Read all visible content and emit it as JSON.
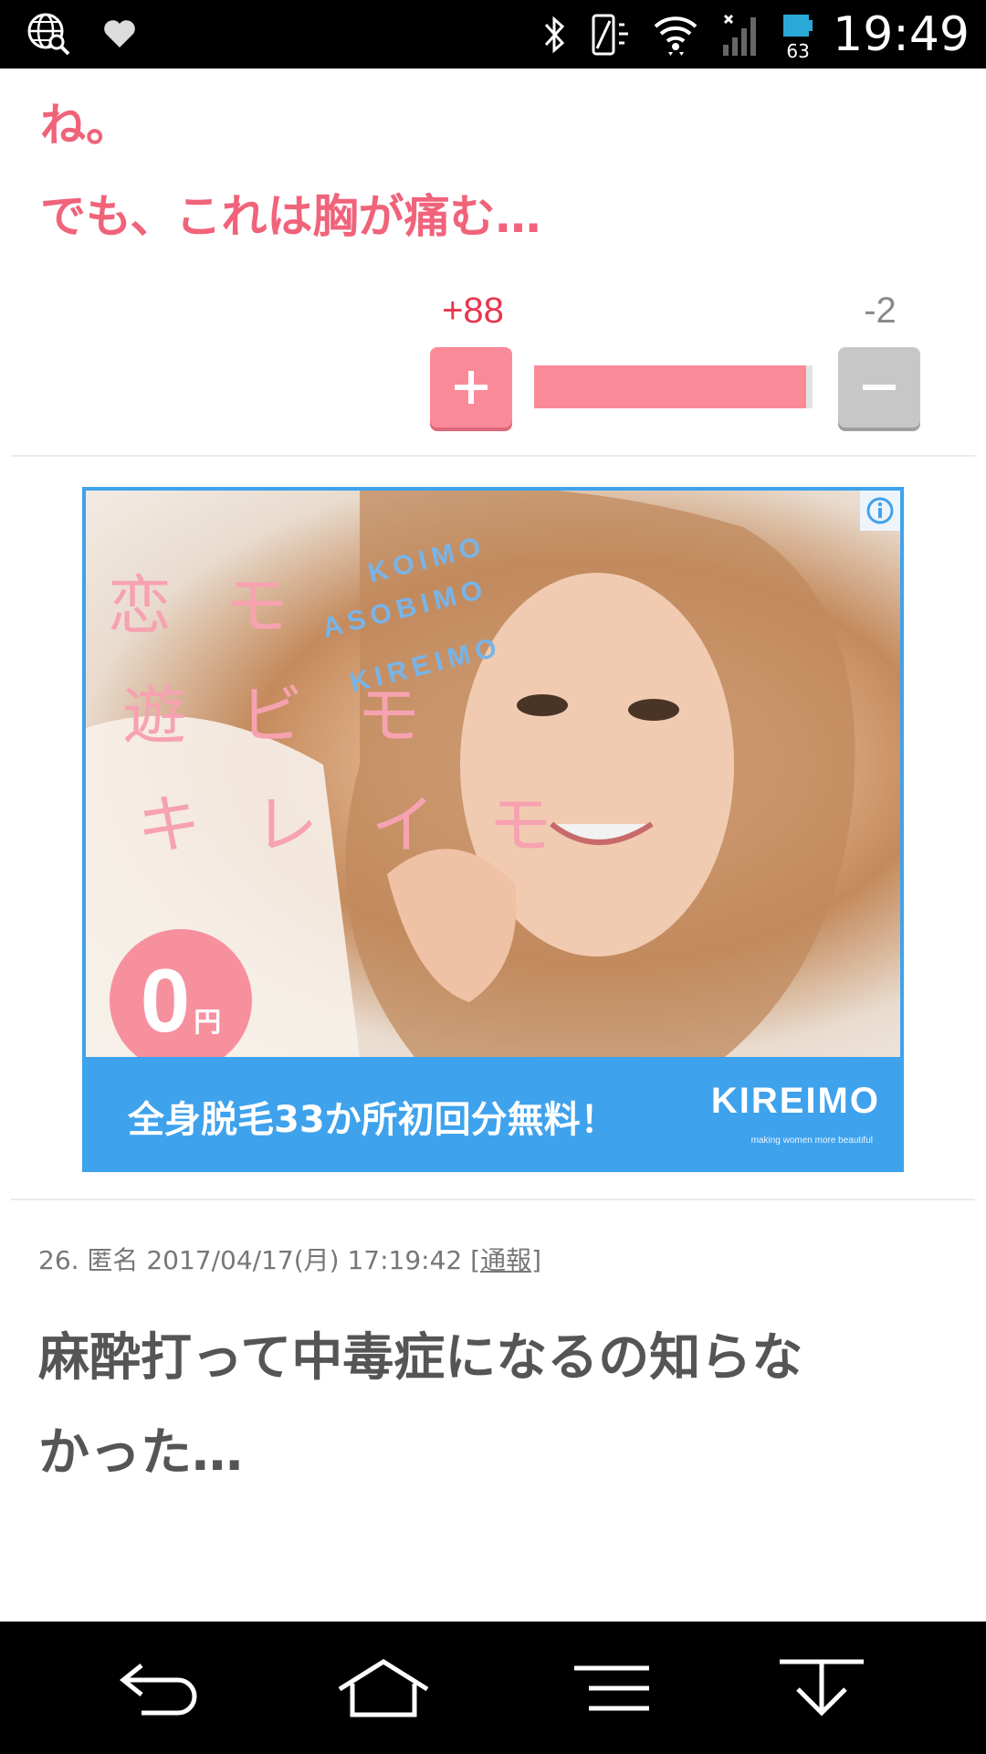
{
  "status_bar": {
    "time": "19:49",
    "battery_level": "63",
    "icons": [
      "globe-search-icon",
      "heart-icon",
      "bluetooth-icon",
      "vibrate-icon",
      "wifi-icon",
      "signal-icon",
      "battery-icon"
    ]
  },
  "comment_prev": {
    "text": "ね。\nでも、これは胸が痛む…",
    "votes_plus": "+88",
    "votes_minus": "-2",
    "vote_ratio": 0.978
  },
  "ad": {
    "jp_lines": [
      "恋 モ",
      "遊 ビ モ",
      "キ レ イ モ"
    ],
    "en_lines": [
      "KOIMO",
      "ASOBIMO",
      "KIREIMO"
    ],
    "badge_number": "0",
    "badge_unit": "円",
    "banner_text": "全身脱毛33か所初回分無料！",
    "logo": "KIREIMO",
    "logo_tagline": "making women more beautiful",
    "colors": {
      "banner": "#3fa2ec",
      "pink": "#f7909d"
    }
  },
  "comment_26": {
    "meta": "26. 匿名 2017/04/17(月) 17:19:42 ",
    "report_open": "[",
    "report_label": "通報",
    "report_close": "]",
    "text": "麻酔打って中毒症になるの知らな\nかった…"
  },
  "colors": {
    "accent_pink": "#f0637a",
    "plus_button": "#fb8a99",
    "minus_button": "#c7c7c7"
  }
}
